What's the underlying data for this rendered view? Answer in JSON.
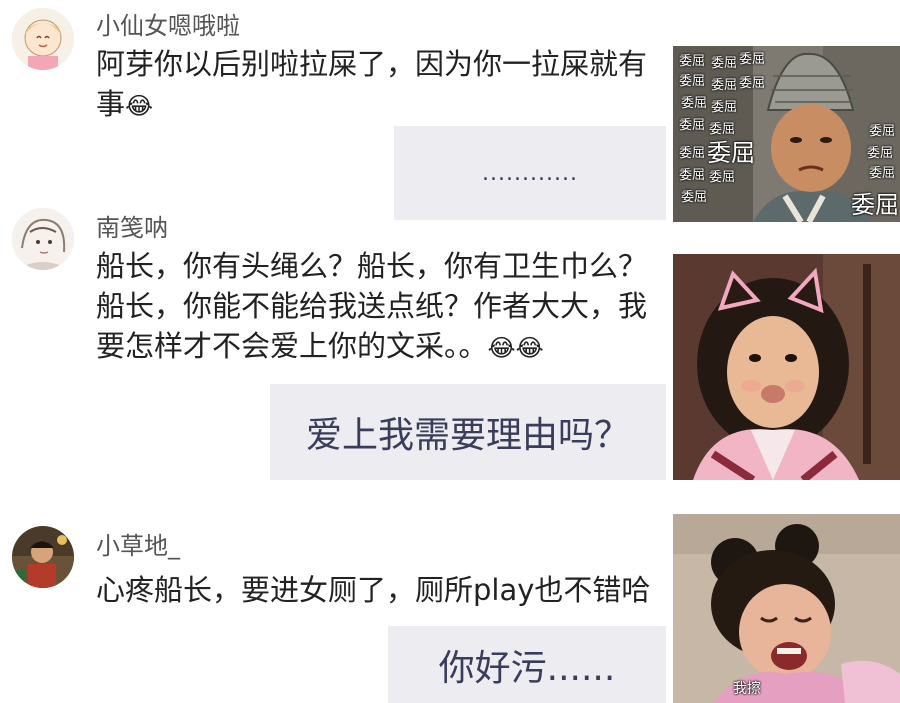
{
  "comments": [
    {
      "username": "小仙女嗯哦啦",
      "text_line1": "阿芽你以后别啦拉屎了，因为你一拉屎就有",
      "text_line2": "事",
      "emoji_icon": "laugh-cry-emoji",
      "reply": "............",
      "sticker_caption": "委屈"
    },
    {
      "username": "南笺呐",
      "text_line1": "船长，你有头绳么？船长，你有卫生巾么？",
      "text_line2": "船长，你能不能给我送点纸？作者大大，我",
      "text_line3": "要怎样才不会爱上你的文采。。",
      "emoji_icon": "laugh-cry-emoji",
      "reply": "爱上我需要理由吗？"
    },
    {
      "username": "小草地_",
      "text_line1": "心疼船长，要进女厕了，厕所play也不错哈",
      "reply": "你好污......",
      "sticker_caption": "我擦"
    }
  ],
  "colors": {
    "reply_bg": "#ececf1",
    "reply_text": "#3a3d5a",
    "username": "#555555"
  }
}
